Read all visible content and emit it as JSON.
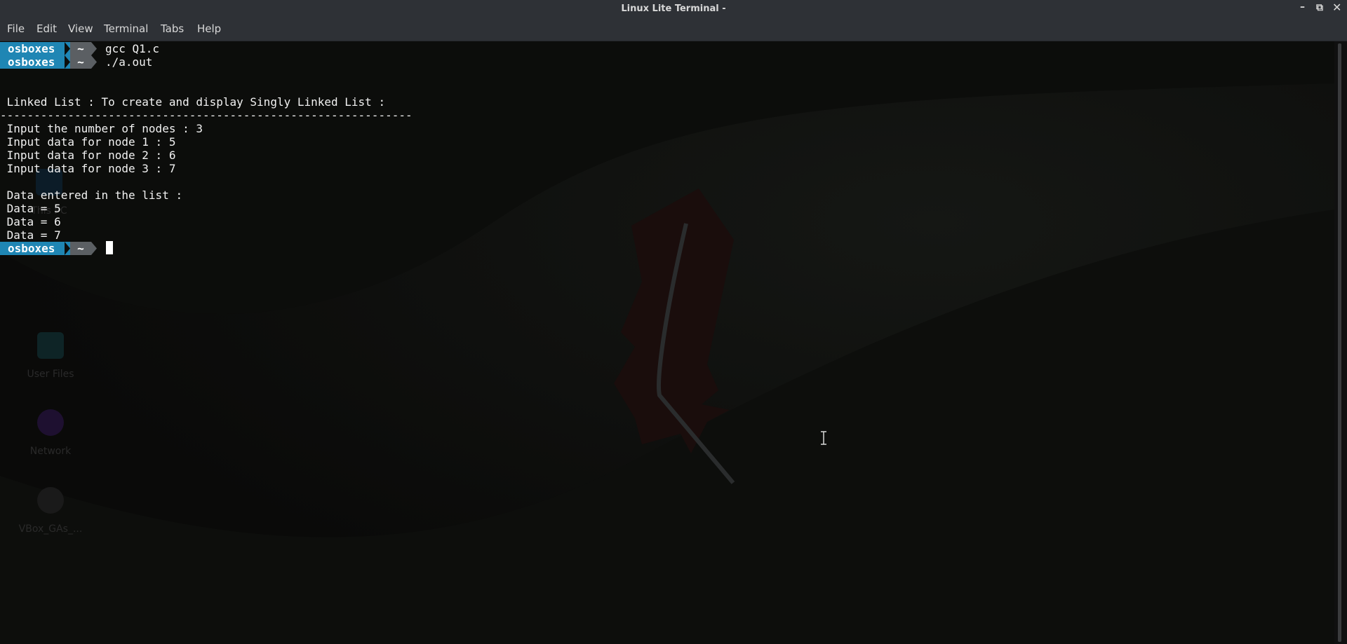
{
  "window": {
    "title": "Linux Lite Terminal -",
    "controls": {
      "minimize": "–",
      "maximize": "⧉",
      "close": "✕"
    }
  },
  "menu": [
    "File",
    "Edit",
    "View",
    "Terminal",
    "Tabs",
    "Help"
  ],
  "prompt": {
    "user": "osboxes",
    "dir": "~"
  },
  "commands": [
    "gcc Q1.c",
    "./a.out"
  ],
  "output": {
    "heading": " Linked List : To create and display Singly Linked List :",
    "separator": "-------------------------------------------------------------",
    "inputs": [
      " Input the number of nodes : 3",
      " Input data for node 1 : 5",
      " Input data for node 2 : 6",
      " Input data for node 3 : 7"
    ],
    "data_heading": " Data entered in the list :",
    "data": [
      " Data = 5",
      " Data = 6",
      " Data = 7"
    ]
  },
  "desktop_icons": [
    "This PC",
    "User Files",
    "Network",
    "VBox_GAs_..."
  ],
  "colors": {
    "prompt_user_bg": "#1f86b4",
    "prompt_dir_bg": "#5b5f63",
    "titlebar_bg": "#2e3136",
    "terminal_bg": "#0b0b0a"
  }
}
